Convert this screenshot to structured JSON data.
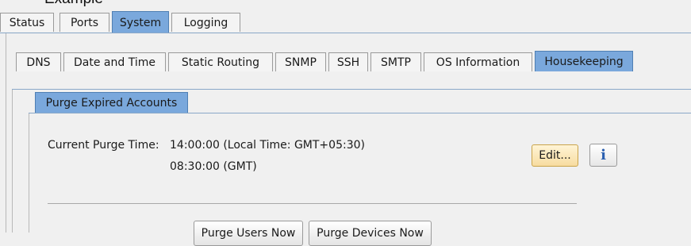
{
  "caption": "Example",
  "top_tabs": [
    {
      "label": "Status",
      "active": false
    },
    {
      "label": "Ports",
      "active": false
    },
    {
      "label": "System",
      "active": true
    },
    {
      "label": "Logging",
      "active": false
    }
  ],
  "sub_tabs": [
    {
      "label": "DNS",
      "active": false
    },
    {
      "label": "Date and Time",
      "active": false
    },
    {
      "label": "Static Routing",
      "active": false
    },
    {
      "label": "SNMP",
      "active": false
    },
    {
      "label": "SSH",
      "active": false
    },
    {
      "label": "SMTP",
      "active": false
    },
    {
      "label": "OS Information",
      "active": false
    },
    {
      "label": "Housekeeping",
      "active": true
    }
  ],
  "section": {
    "title": "Purge Expired Accounts",
    "current_purge_label": "Current Purge Time:",
    "local_time": "14:00:00 (Local Time:  GMT+05:30)",
    "gmt_time": "08:30:00 (GMT)",
    "edit_label": "Edit...",
    "info_icon": "info-icon",
    "info_glyph": "i",
    "purge_users_label": "Purge Users Now",
    "purge_devices_label": "Purge Devices Now"
  },
  "colors": {
    "active_tab": "#7aa8dc",
    "edit_button": "#f7dca0"
  }
}
